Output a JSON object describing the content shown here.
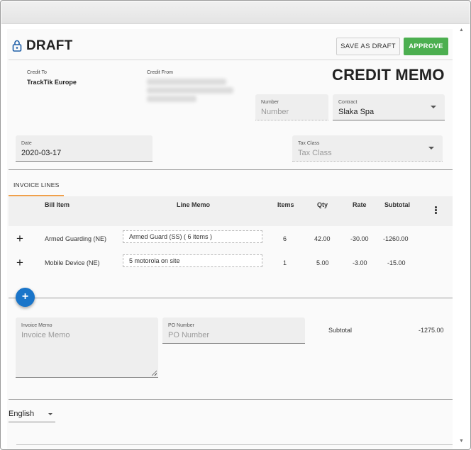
{
  "header": {
    "status_title": "DRAFT",
    "save_draft_label": "SAVE AS DRAFT",
    "approve_label": "APPROVE",
    "document_title": "CREDIT MEMO"
  },
  "parties": {
    "credit_to_label": "Credit To",
    "credit_to_value": "TrackTik Europe",
    "credit_from_label": "Credit From"
  },
  "fields": {
    "number": {
      "label": "Number",
      "placeholder": "Number"
    },
    "contract": {
      "label": "Contract",
      "value": "Slaka Spa"
    },
    "date": {
      "label": "Date",
      "value": "2020-03-17"
    },
    "tax_class": {
      "label": "Tax Class",
      "placeholder": "Tax Class"
    }
  },
  "tabs": [
    {
      "label": "INVOICE LINES",
      "active": true
    }
  ],
  "table": {
    "columns": [
      "Bill Item",
      "Line Memo",
      "Items",
      "Qty",
      "Rate",
      "Subtotal"
    ],
    "rows": [
      {
        "add": "+",
        "bill_item": "Armed Guarding (NE)",
        "line_memo": "Armed Guard (SS) ( 6 items )",
        "items": "6",
        "qty": "42.00",
        "rate": "-30.00",
        "subtotal": "-1260.00"
      },
      {
        "add": "+",
        "bill_item": "Mobile Device (NE)",
        "line_memo": "5 motorola on site",
        "items": "1",
        "qty": "5.00",
        "rate": "-3.00",
        "subtotal": "-15.00"
      }
    ]
  },
  "footer": {
    "add_line": "+",
    "invoice_memo": {
      "label": "Invoice Memo",
      "placeholder": "Invoice Memo"
    },
    "po_number": {
      "label": "PO Number",
      "placeholder": "PO Number"
    },
    "subtotal_label": "Subtotal",
    "subtotal_value": "-1275.00"
  },
  "language": {
    "value": "English"
  },
  "colors": {
    "approve": "#4caf50",
    "tab_underline": "#f0a04b",
    "fab": "#1a75c9",
    "lock": "#1f5fa8"
  },
  "icons": [
    "lock-icon",
    "plus-icon",
    "kebab-menu-icon",
    "chevron-down-icon",
    "resize-grip-icon"
  ]
}
